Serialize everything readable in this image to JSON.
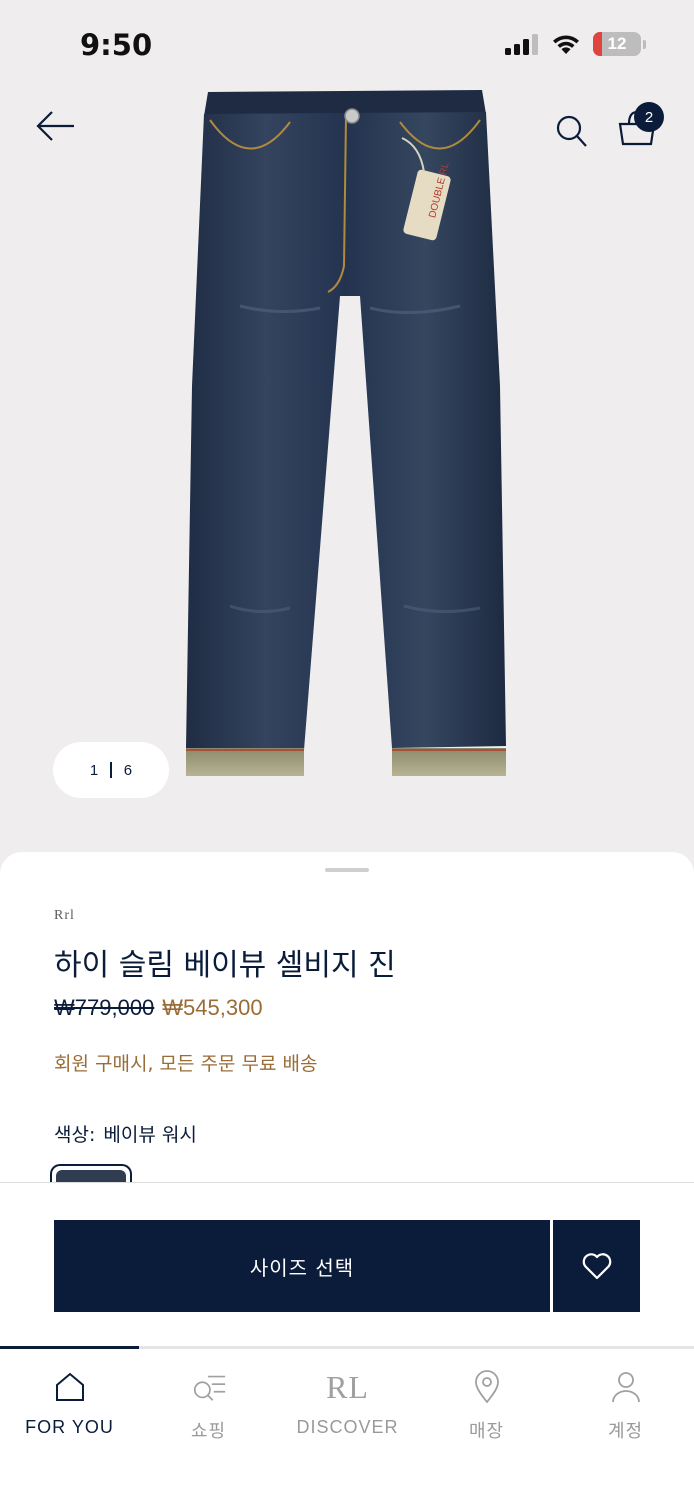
{
  "status_bar": {
    "time": "9:50",
    "battery_level": "12",
    "icons": [
      "cellular-signal-icon",
      "wifi-icon",
      "battery-icon"
    ]
  },
  "header": {
    "back_icon": "arrow-left-icon",
    "search_icon": "search-icon",
    "cart_icon": "shopping-bag-icon",
    "cart_count": "2"
  },
  "gallery": {
    "current": "1",
    "total": "6"
  },
  "product": {
    "brand": "Rrl",
    "name": "하이 슬림 베이뷰 셀비지 진",
    "price_original": "₩779,000",
    "price_sale": "₩545,300",
    "promo": "회원 구매시, 모든 주문 무료 배송",
    "color_label": "색상:",
    "color_value": "베이뷰 워시"
  },
  "actions": {
    "select_size_label": "사이즈 선택",
    "wishlist_icon": "heart-icon"
  },
  "tab_bar": {
    "tabs": [
      {
        "label": "FOR YOU",
        "icon": "home-icon",
        "active": true
      },
      {
        "label": "쇼핑",
        "icon": "search-list-icon",
        "active": false
      },
      {
        "label": "DISCOVER",
        "icon": "rl-logo-icon",
        "active": false
      },
      {
        "label": "매장",
        "icon": "location-pin-icon",
        "active": false
      },
      {
        "label": "계정",
        "icon": "person-icon",
        "active": false
      }
    ],
    "discover_logo_text": "RL"
  },
  "colors": {
    "navy": "#0b1c3a",
    "gold": "#9a6c37",
    "hero_bg": "#efeded",
    "denim": "#2a3850"
  }
}
